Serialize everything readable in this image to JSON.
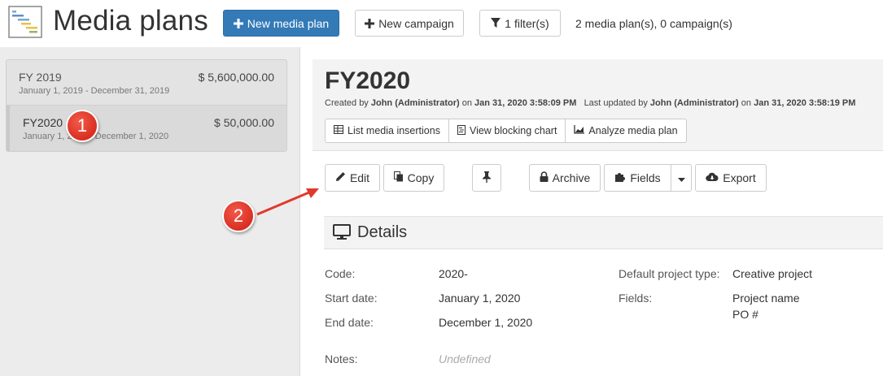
{
  "header": {
    "title": "Media plans",
    "new_media_plan_label": "New media plan",
    "new_campaign_label": "New campaign",
    "filter_label": "1 filter(s)",
    "summary": "2 media plan(s), 0 campaign(s)"
  },
  "sidebar": {
    "plans": [
      {
        "name": "FY 2019",
        "dates": "January 1, 2019 - December 31, 2019",
        "amount": "$ 5,600,000.00"
      },
      {
        "name": "FY2020",
        "dates": "January 1, 2020 - December 1, 2020",
        "amount": "$ 50,000.00"
      }
    ]
  },
  "plan": {
    "title": "FY2020",
    "created_prefix": "Created by",
    "created_by": "John (Administrator)",
    "created_on_word": "on",
    "created_at": "Jan 31, 2020 3:58:09 PM",
    "updated_prefix": "Last updated by",
    "updated_by": "John (Administrator)",
    "updated_on_word": "on",
    "updated_at": "Jan 31, 2020 3:58:19 PM",
    "links": {
      "list_insertions": "List media insertions",
      "blocking_chart": "View blocking chart",
      "analyze": "Analyze media plan"
    }
  },
  "toolbar": {
    "edit": "Edit",
    "copy": "Copy",
    "archive": "Archive",
    "fields": "Fields",
    "export": "Export"
  },
  "details": {
    "title": "Details",
    "code_label": "Code:",
    "code_value": "2020-",
    "start_label": "Start date:",
    "start_value": "January 1, 2020",
    "end_label": "End date:",
    "end_value": "December 1, 2020",
    "notes_label": "Notes:",
    "notes_value": "Undefined",
    "project_type_label": "Default project type:",
    "project_type_value": "Creative project",
    "fields_label": "Fields:",
    "fields_values": [
      "Project name",
      "PO #"
    ]
  },
  "annotations": {
    "badge_1": "1",
    "badge_2": "2",
    "badge_color": "#e03a2c"
  },
  "colors": {
    "primary": "#337ab7",
    "sidebar_bg": "#ececec",
    "header_bg": "#f3f3f3"
  }
}
